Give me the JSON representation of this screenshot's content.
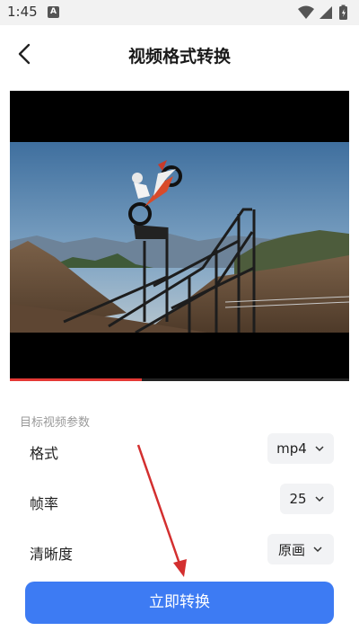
{
  "status_bar": {
    "time": "1:45",
    "notification_letter": "A"
  },
  "header": {
    "title": "视频格式转换"
  },
  "params": {
    "section_label": "目标视频参数",
    "format": {
      "label": "格式",
      "value": "mp4"
    },
    "frame_rate": {
      "label": "帧率",
      "value": "25"
    },
    "resolution": {
      "label": "清晰度",
      "value": "原画"
    }
  },
  "video": {
    "progress": 0.39
  },
  "action": {
    "convert_label": "立即转换"
  },
  "colors": {
    "accent": "#3d7bf3",
    "progress": "#e53935",
    "annotation_arrow": "#d32f2f"
  }
}
